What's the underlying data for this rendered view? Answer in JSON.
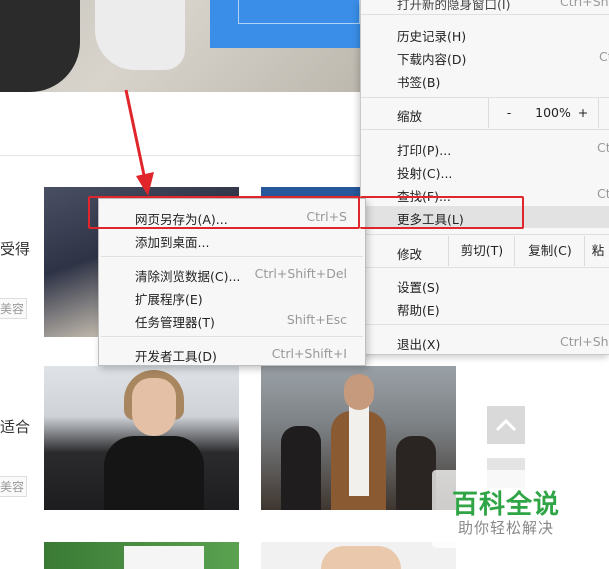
{
  "page": {
    "side_texts": [
      "受得",
      "适合"
    ],
    "tags": [
      "美容",
      "美容"
    ]
  },
  "main_menu": {
    "top_partial_label": "打开新的隐身窗口(I)",
    "top_partial_shortcut": "Ctrl+Shi",
    "items": [
      {
        "label": "历史记录(H)",
        "shortcut": ""
      },
      {
        "label": "下载内容(D)",
        "shortcut": "Ctrl"
      },
      {
        "label": "书签(B)",
        "shortcut": ""
      }
    ],
    "zoom": {
      "label": "缩放",
      "minus": "-",
      "value": "100%",
      "plus": "+"
    },
    "items2": [
      {
        "label": "打印(P)...",
        "shortcut": "Ct"
      },
      {
        "label": "投射(C)...",
        "shortcut": ""
      },
      {
        "label": "查找(F)...",
        "shortcut": "Ct"
      },
      {
        "label": "更多工具(L)",
        "shortcut": ""
      }
    ],
    "edit": {
      "label": "修改",
      "cut": "剪切(T)",
      "copy": "复制(C)",
      "paste": "粘"
    },
    "items3": [
      {
        "label": "设置(S)"
      },
      {
        "label": "帮助(E)"
      }
    ],
    "exit": {
      "label": "退出(X)",
      "shortcut": "Ctrl+Shif"
    }
  },
  "sub_menu": {
    "items": [
      {
        "label": "网页另存为(A)...",
        "shortcut": "Ctrl+S"
      },
      {
        "label": "添加到桌面...",
        "shortcut": ""
      },
      {
        "label": "清除浏览数据(C)...",
        "shortcut": "Ctrl+Shift+Del"
      },
      {
        "label": "扩展程序(E)",
        "shortcut": ""
      },
      {
        "label": "任务管理器(T)",
        "shortcut": "Shift+Esc"
      },
      {
        "label": "开发者工具(D)",
        "shortcut": "Ctrl+Shift+I"
      }
    ]
  },
  "watermark": {
    "title": "百科全说",
    "subtitle": "助你轻松解决"
  },
  "colors": {
    "annotation": "#e0262a",
    "watermark_green": "#2fa546",
    "menu_bg": "#f7f7f7"
  }
}
